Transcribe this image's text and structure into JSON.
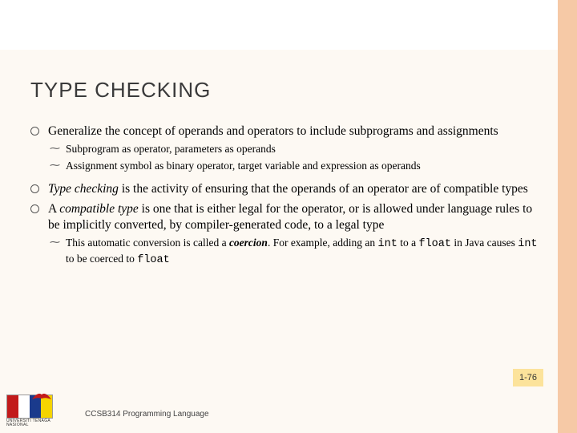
{
  "title": "TYPE CHECKING",
  "bullets": {
    "b1a": "Generalize the concept of operands and operators to include subprograms and assignments",
    "b1a_s1": "Subprogram as operator, parameters as operands",
    "b1a_s2": "Assignment symbol as binary operator, target variable and expression as operands",
    "b1b_em": "Type checking",
    "b1b_rest": " is the activity of ensuring that the operands of an operator are of compatible types",
    "b1c_pre": "A ",
    "b1c_em": "compatible type",
    "b1c_rest": " is one that is either legal for the operator, or is allowed under language rules to be implicitly converted, by compiler-generated code, to a legal type",
    "b1c_s1_pre": "This automatic conversion is called a ",
    "b1c_s1_em": "coercion",
    "b1c_s1_mid1": ".  For example, adding an ",
    "b1c_s1_code1": "int",
    "b1c_s1_mid2": " to a ",
    "b1c_s1_code2": "float",
    "b1c_s1_mid3": " in Java causes ",
    "b1c_s1_code3": "int",
    "b1c_s1_mid4": " to be coerced to ",
    "b1c_s1_code4": "float"
  },
  "pagenum": "1-76",
  "footer": "CCSB314 Programming Language",
  "logo_text": "UNIVERSITI TENAGA NASIONAL"
}
